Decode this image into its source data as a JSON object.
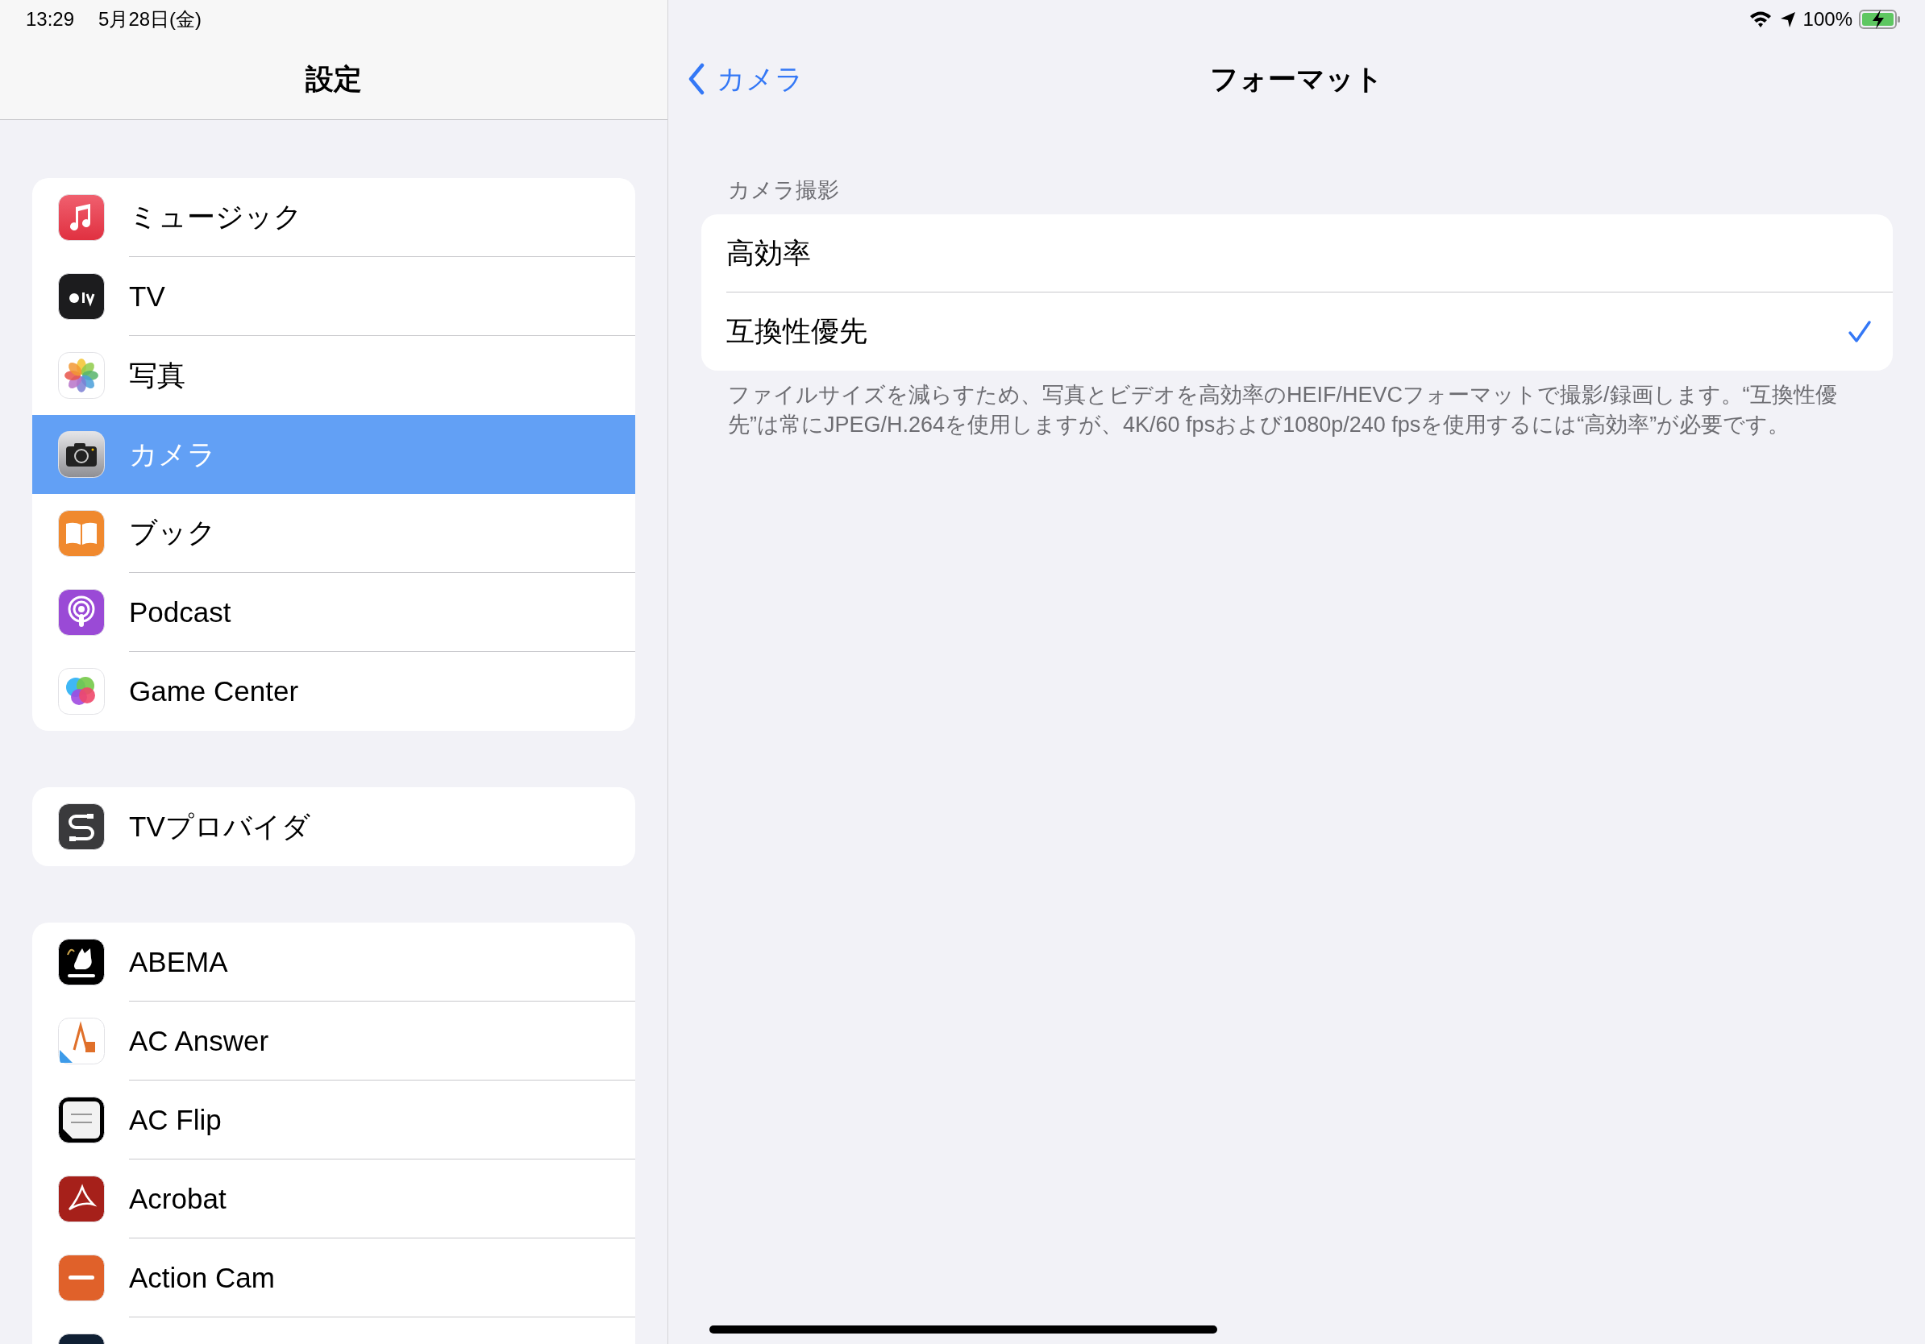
{
  "status_bar": {
    "time": "13:29",
    "date": "5月28日(金)",
    "battery": "100%"
  },
  "sidebar": {
    "title": "設定",
    "groups": [
      {
        "items": [
          {
            "label": "ミュージック",
            "kind": "music",
            "selected": false
          },
          {
            "label": "TV",
            "kind": "tv",
            "selected": false
          },
          {
            "label": "写真",
            "kind": "photos",
            "selected": false
          },
          {
            "label": "カメラ",
            "kind": "camera",
            "selected": true
          },
          {
            "label": "ブック",
            "kind": "books",
            "selected": false
          },
          {
            "label": "Podcast",
            "kind": "podcast",
            "selected": false
          },
          {
            "label": "Game Center",
            "kind": "gamecenter",
            "selected": false
          }
        ]
      },
      {
        "items": [
          {
            "label": "TVプロバイダ",
            "kind": "tvprovider",
            "selected": false
          }
        ]
      },
      {
        "items": [
          {
            "label": "ABEMA",
            "kind": "abema",
            "selected": false
          },
          {
            "label": "AC Answer",
            "kind": "acanswer",
            "selected": false
          },
          {
            "label": "AC Flip",
            "kind": "acflip",
            "selected": false
          },
          {
            "label": "Acrobat",
            "kind": "acrobat",
            "selected": false
          },
          {
            "label": "Action Cam",
            "kind": "actioncam",
            "selected": false
          },
          {
            "kind": "dark",
            "selected": false
          }
        ]
      }
    ]
  },
  "detail": {
    "back": "カメラ",
    "title": "フォーマット",
    "section_header": "カメラ撮影",
    "options": [
      {
        "label": "高効率",
        "selected": false
      },
      {
        "label": "互換性優先",
        "selected": true
      }
    ],
    "footer": "ファイルサイズを減らすため、写真とビデオを高効率のHEIF/HEVCフォーマットで撮影/録画します。“互換性優先”は常にJPEG/H.264を使用しますが、4K/60 fpsおよび1080p/240 fpsを使用するには“高効率”が必要です。"
  }
}
